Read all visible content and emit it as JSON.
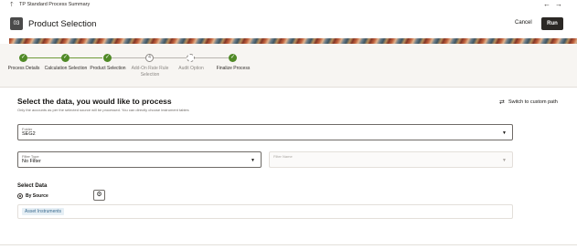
{
  "topbar": {
    "breadcrumb": "TP Standard Process Summary",
    "back_icon": "arrow-left-icon",
    "forward_icon": "arrow-right-icon"
  },
  "header": {
    "step_number": "03",
    "title": "Product Selection",
    "cancel_label": "Cancel",
    "run_label": "Run"
  },
  "train": {
    "steps": [
      {
        "label": "Process Details",
        "state": "done"
      },
      {
        "label": "Calculation Selection",
        "state": "done"
      },
      {
        "label": "Product Selection",
        "state": "done"
      },
      {
        "label": "Add-On Rate Rule Selection",
        "state": "pending",
        "marker": "4"
      },
      {
        "label": "Audit Option",
        "state": "dashed",
        "marker": ""
      },
      {
        "label": "Finalize Process",
        "state": "done"
      }
    ]
  },
  "content": {
    "title": "Select the data, you would like to process",
    "subtitle": "Only the accounts as per the selected source will be processed. You can directly choose instrument tables",
    "switch_label": "Switch to custom path",
    "folder": {
      "label": "Folder",
      "value": "SEG2"
    },
    "filter_type": {
      "label": "Filter Type",
      "value": "No Filter"
    },
    "filter_name": {
      "label": "Filter Name",
      "value": ""
    },
    "select_data_title": "Select Data",
    "by_source_label": "By Source",
    "chip_label": "Asset Instruments"
  }
}
